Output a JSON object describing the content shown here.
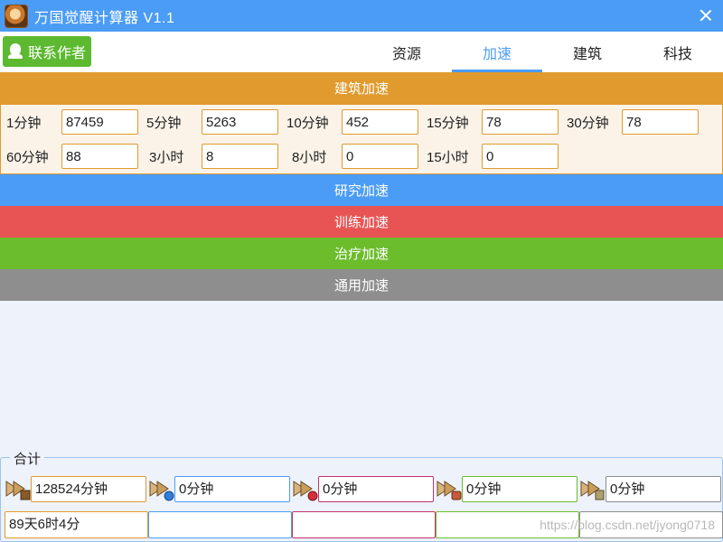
{
  "window": {
    "title": "万国觉醒计算器 V1.1"
  },
  "header": {
    "contact_label": "联系作者",
    "tabs": [
      {
        "label": "资源",
        "active": false
      },
      {
        "label": "加速",
        "active": true
      },
      {
        "label": "建筑",
        "active": false
      },
      {
        "label": "科技",
        "active": false
      }
    ]
  },
  "sections": {
    "building": {
      "label": "建筑加速",
      "color": "#e09a2d"
    },
    "research": {
      "label": "研究加速",
      "color": "#4b9cf5"
    },
    "training": {
      "label": "训练加速",
      "color": "#e85454"
    },
    "healing": {
      "label": "治疗加速",
      "color": "#6bbd2b"
    },
    "universal": {
      "label": "通用加速",
      "color": "#8e8e8e"
    }
  },
  "building_fields": [
    {
      "label": "1分钟",
      "value": "87459"
    },
    {
      "label": "5分钟",
      "value": "5263"
    },
    {
      "label": "10分钟",
      "value": "452"
    },
    {
      "label": "15分钟",
      "value": "78"
    },
    {
      "label": "30分钟",
      "value": "78"
    },
    {
      "label": "60分钟",
      "value": "88"
    },
    {
      "label": "3小时",
      "value": "8"
    },
    {
      "label": "8小时",
      "value": "0"
    },
    {
      "label": "15小时",
      "value": "0"
    }
  ],
  "summary": {
    "legend": "合计",
    "totals": [
      {
        "value": "128524分钟",
        "icon": "building-speedup-icon",
        "color": "#e09a2d"
      },
      {
        "value": "0分钟",
        "icon": "research-speedup-icon",
        "color": "#4b9cf5"
      },
      {
        "value": "0分钟",
        "icon": "training-speedup-icon",
        "color": "#c2336b"
      },
      {
        "value": "0分钟",
        "icon": "healing-speedup-icon",
        "color": "#6bbd2b"
      },
      {
        "value": "0分钟",
        "icon": "universal-speedup-icon",
        "color": "#8e8e8e"
      }
    ],
    "durations": [
      {
        "value": "89天6时4分",
        "color": "#e09a2d"
      },
      {
        "value": "",
        "color": "#4b9cf5"
      },
      {
        "value": "",
        "color": "#c2336b"
      },
      {
        "value": "",
        "color": "#6bbd2b"
      },
      {
        "value": "",
        "color": "#8e8e8e"
      }
    ]
  },
  "watermark": "https://blog.csdn.net/jyong0718"
}
